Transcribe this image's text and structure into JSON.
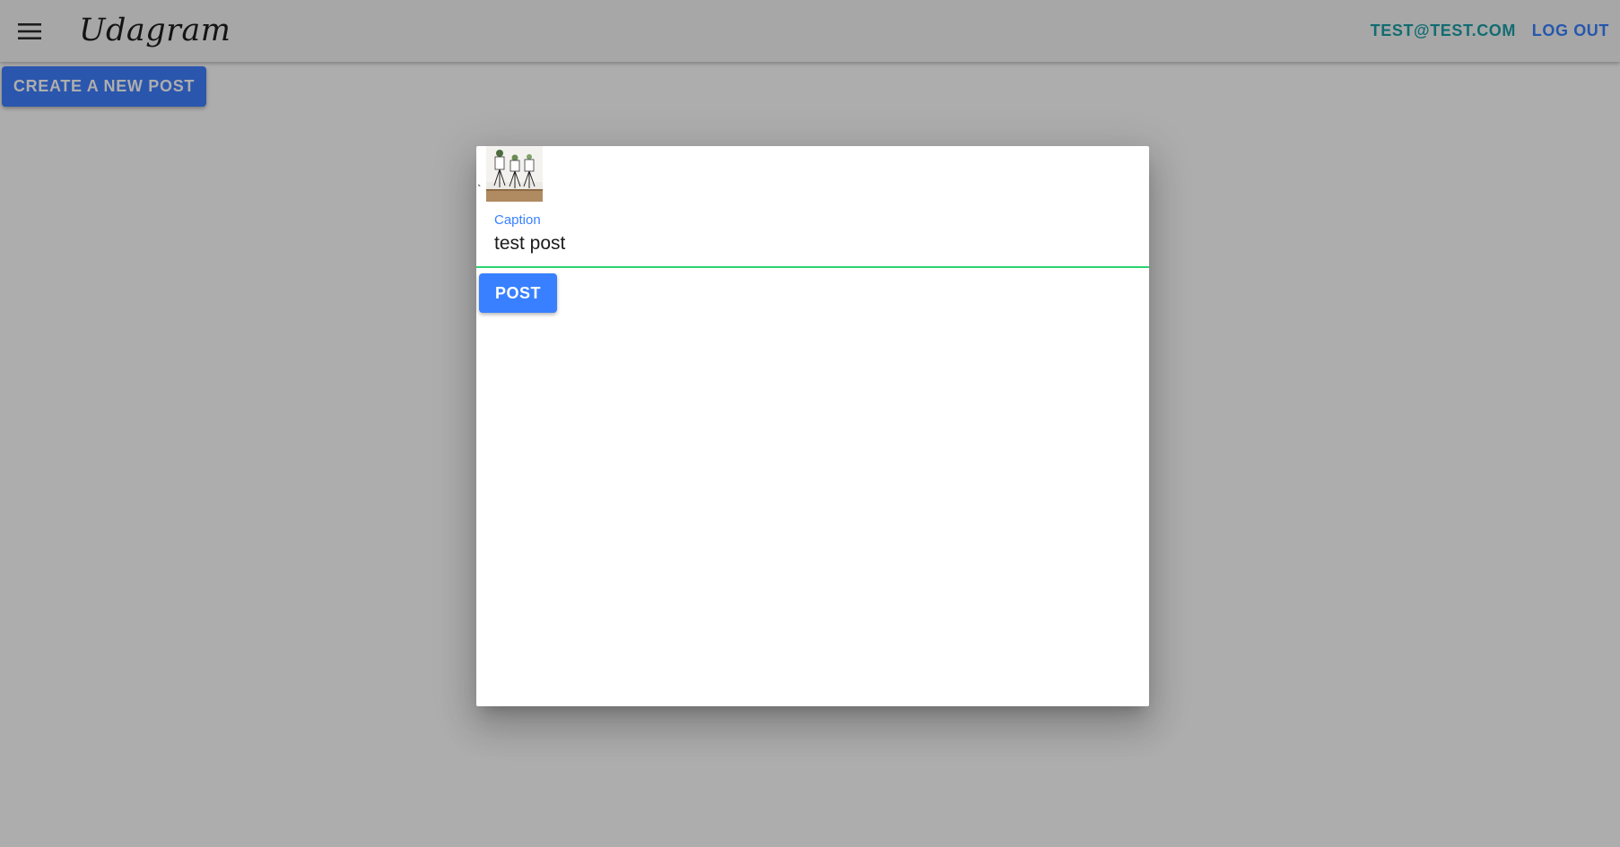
{
  "colors": {
    "accent_teal": "#1c9fa8",
    "primary_blue": "#3880ff",
    "create_button": "#3f7fff",
    "label_blue": "#3880ff",
    "focus_underline": "#2dd36f"
  },
  "header": {
    "menu_icon": "hamburger-menu-icon",
    "title": "Udagram",
    "user_email": "TEST@TEST.COM",
    "logout_label": "LOG OUT"
  },
  "main": {
    "create_post_label": "CREATE A NEW POST"
  },
  "dialog": {
    "stray_char": "`",
    "preview_image": "plants-on-stands-thumbnail",
    "caption": {
      "label": "Caption",
      "value": "test post"
    },
    "post_label": "POST"
  }
}
